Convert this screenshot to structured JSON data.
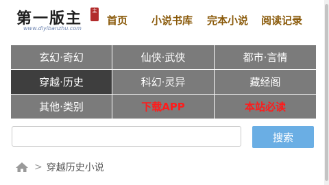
{
  "header": {
    "logo_text": "第一版主",
    "logo_seal": "主",
    "logo_url": "www.diyibanzhu.com",
    "nav": [
      "首页",
      "小说书库",
      "完本小说",
      "阅读记录"
    ]
  },
  "menu": [
    {
      "label": "玄幻·奇幻",
      "style": "normal"
    },
    {
      "label": "仙侠·武侠",
      "style": "normal"
    },
    {
      "label": "都市·言情",
      "style": "normal"
    },
    {
      "label": "穿越·历史",
      "style": "active"
    },
    {
      "label": "科幻·灵异",
      "style": "normal"
    },
    {
      "label": "藏经阁",
      "style": "normal"
    },
    {
      "label": "其他·类别",
      "style": "normal"
    },
    {
      "label": "下载APP",
      "style": "red"
    },
    {
      "label": "本站必读",
      "style": "red"
    }
  ],
  "search": {
    "value": "",
    "placeholder": "",
    "button_label": "搜索"
  },
  "breadcrumb": {
    "home_icon": "home-icon",
    "separator": ">",
    "current": "穿越历史小说"
  },
  "colors": {
    "menu_bg": "#7b7b7b",
    "menu_active_bg": "#3e3e3e",
    "menu_red_text": "#ff1b1b",
    "nav_text": "#8a5a0a",
    "search_button": "#6aaee4"
  }
}
